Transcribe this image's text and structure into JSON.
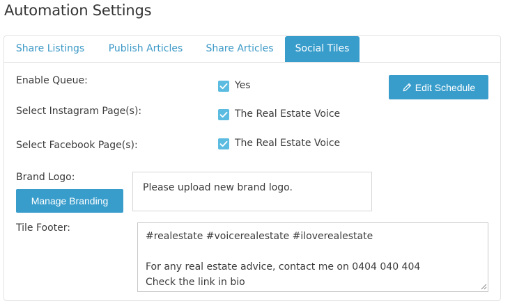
{
  "page": {
    "title": "Automation Settings"
  },
  "tabs": [
    {
      "label": "Share Listings",
      "active": false
    },
    {
      "label": "Publish Articles",
      "active": false
    },
    {
      "label": "Share Articles",
      "active": false
    },
    {
      "label": "Social Tiles",
      "active": true
    }
  ],
  "form": {
    "enable_queue": {
      "label": "Enable Queue:",
      "checkbox_label": "Yes",
      "checked": true
    },
    "instagram": {
      "label": "Select Instagram Page(s):",
      "checkbox_label": "The Real Estate Voice",
      "checked": true
    },
    "facebook": {
      "label": "Select Facebook Page(s):",
      "checkbox_label": "The Real Estate Voice",
      "checked": true
    },
    "brand_logo": {
      "label": "Brand Logo:",
      "button_label": "Manage Branding",
      "placeholder_text": "Please upload new brand logo."
    },
    "tile_footer": {
      "label": "Tile Footer:",
      "value": "#realestate #voicerealestate #iloverealestate\n\nFor any real estate advice, contact me on 0404 040 404\nCheck the link in bio"
    }
  },
  "actions": {
    "edit_schedule_label": "Edit Schedule",
    "edit_icon": "pencil-icon"
  },
  "colors": {
    "accent": "#399dcc",
    "checkbox": "#5bbbe0",
    "tab_text": "#3a98c6"
  }
}
